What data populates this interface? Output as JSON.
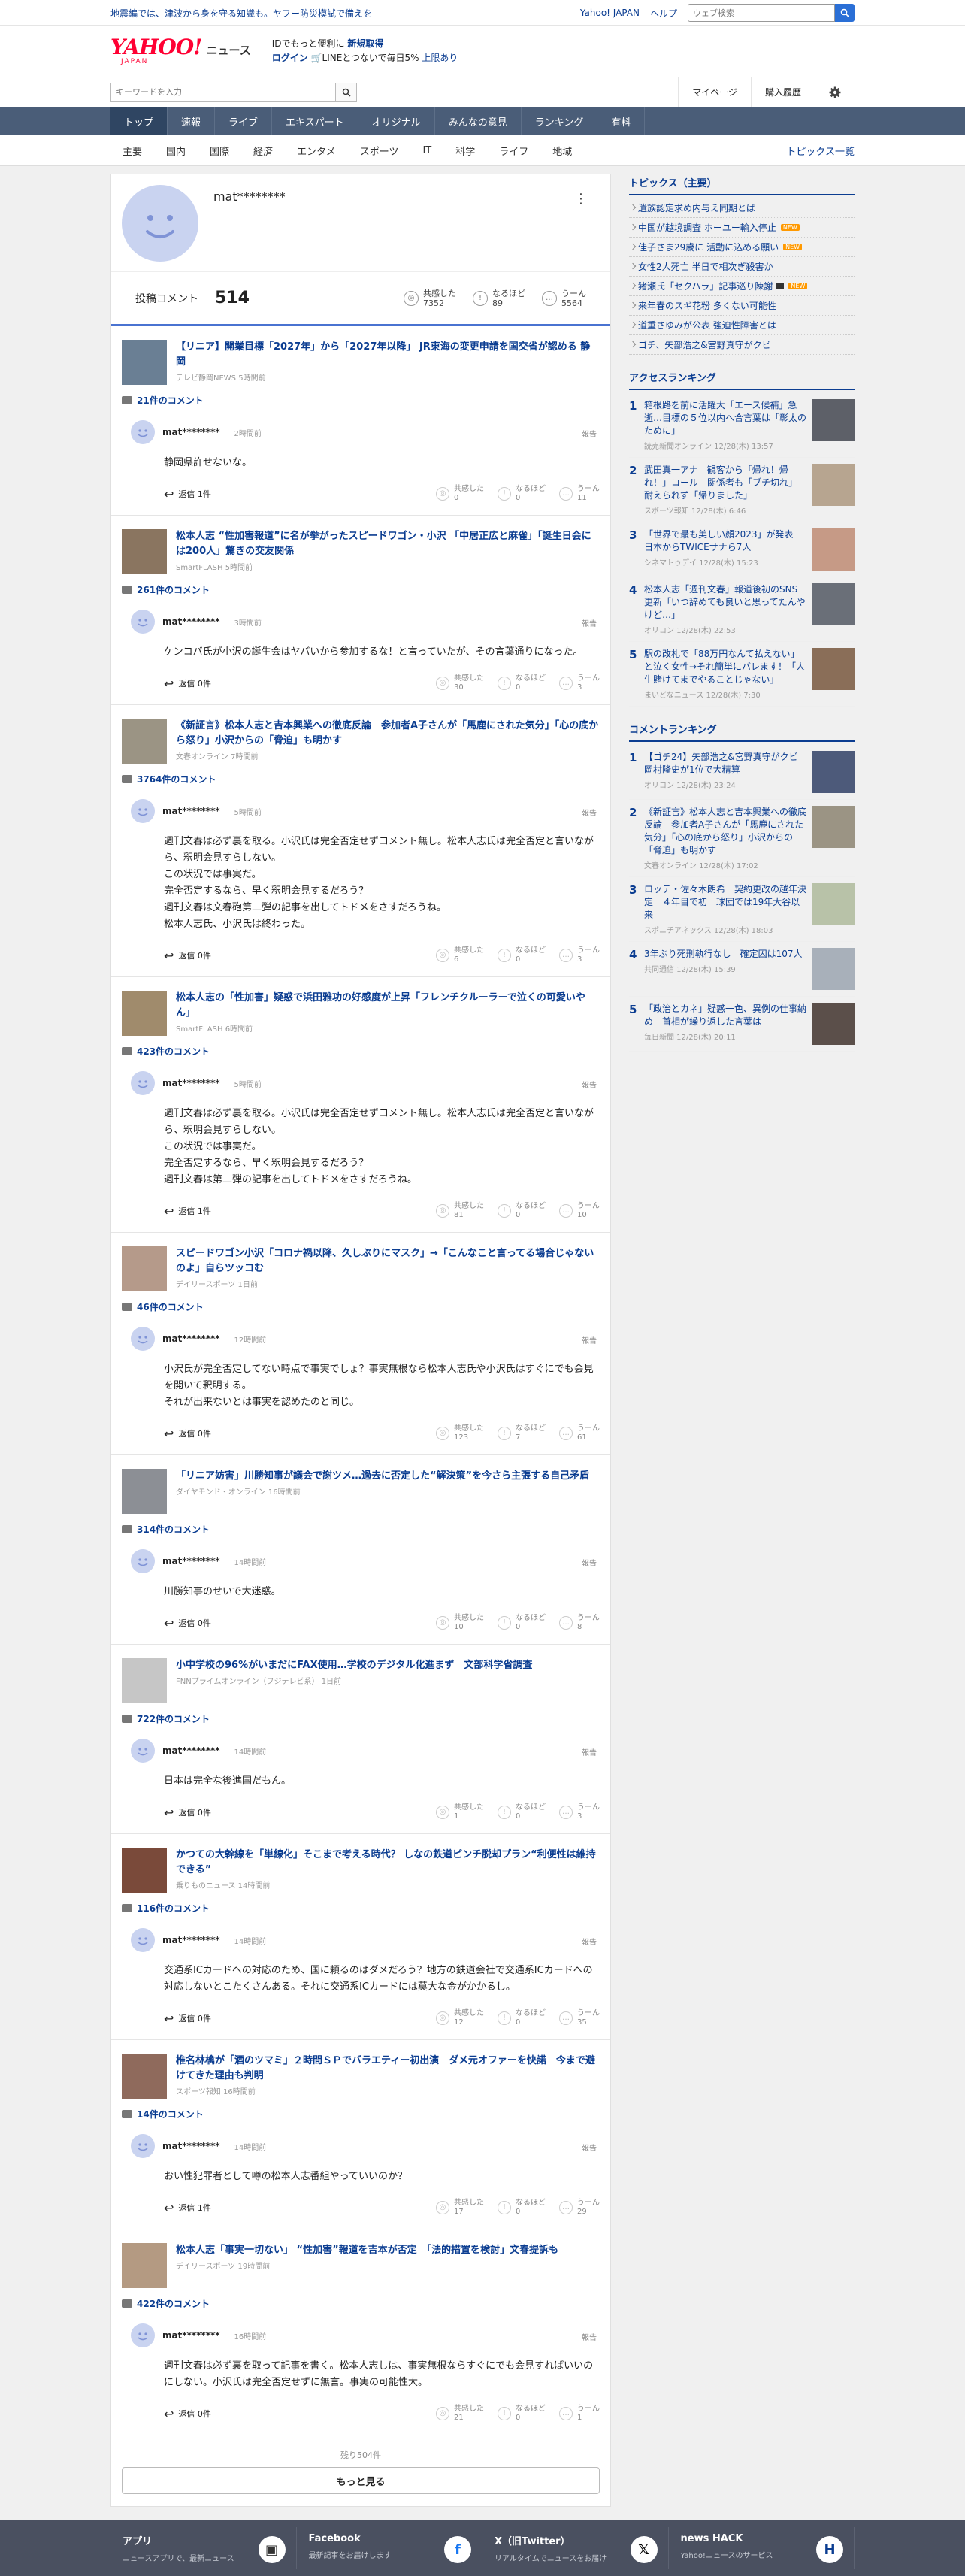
{
  "topbar": {
    "notice": "地震編では、津波から身を守る知識も。ヤフー防災模試で備えを",
    "yahoo_japan": "Yahoo! JAPAN",
    "help": "ヘルプ",
    "web_search_placeholder": "ウェブ検索"
  },
  "header": {
    "logo": "YAHOO!",
    "logo_sub": "JAPAN",
    "logo_news": "ニュース",
    "promo_line1_prefix": "IDでもっと便利に",
    "promo_line1_link": "新規取得",
    "promo_login": "ログイン",
    "promo_line2": "LINEとつないで毎日5%",
    "promo_limit": "上限あり"
  },
  "subbar": {
    "search_placeholder": "キーワードを入力",
    "mypage": "マイページ",
    "history": "購入履歴"
  },
  "gnav": [
    "トップ",
    "速報",
    "ライブ",
    "エキスパート",
    "オリジナル",
    "みんなの意見",
    "ランキング",
    "有料"
  ],
  "cnav": {
    "items": [
      "主要",
      "国内",
      "国際",
      "経済",
      "エンタメ",
      "スポーツ",
      "IT",
      "科学",
      "ライフ",
      "地域"
    ],
    "more": "トピックス一覧"
  },
  "profile": {
    "name": "mat********",
    "posted_label": "投稿コメント",
    "posted_count": "514",
    "reactions": [
      {
        "label": "共感した",
        "count": "7352"
      },
      {
        "label": "なるほど",
        "count": "89"
      },
      {
        "label": "うーん",
        "count": "5564"
      }
    ]
  },
  "comment_labels": {
    "reply_suffix": "返信",
    "report": "報告",
    "empathy": "共感した",
    "naruhodo": "なるほど",
    "uun": "うーん"
  },
  "items": [
    {
      "title": "【リニア】開業目標「2027年」から「2027年以降」 JR東海の変更申請を国交省が認める 静岡",
      "source": "テレビ静岡NEWS 5時間前",
      "comment_count": "21件のコメント",
      "user": "mat********",
      "time": "2時間前",
      "text": "静岡県許せないな。",
      "replies": "返信 1件",
      "empathy": "0",
      "naruhodo": "0",
      "uun": "11"
    },
    {
      "title": "松本人志 “性加害報道”に名が挙がったスピードワゴン・小沢 「中居正広と麻雀」「誕生日会には200人」驚きの交友関係",
      "source": "SmartFLASH 5時間前",
      "comment_count": "261件のコメント",
      "user": "mat********",
      "time": "3時間前",
      "text": "ケンコバ氏が小沢の誕生会はヤバいから参加するな！と言っていたが、その言葉通りになった。",
      "replies": "返信 0件",
      "empathy": "30",
      "naruhodo": "0",
      "uun": "3"
    },
    {
      "title": "《新証言》松本人志と吉本興業への徹底反論　参加者A子さんが「馬鹿にされた気分」「心の底から怒り」小沢からの「脅迫」も明かす",
      "source": "文春オンライン 7時間前",
      "comment_count": "3764件のコメント",
      "user": "mat********",
      "time": "5時間前",
      "text": "週刊文春は必ず裏を取る。小沢氏は完全否定せずコメント無し。松本人志氏は完全否定と言いながら、釈明会見すらしない。\nこの状況では事実だ。\n完全否定するなら、早く釈明会見するだろう？\n週刊文春は文春砲第二弾の記事を出してトドメをさすだろうね。\n松本人志氏、小沢氏は終わった。",
      "replies": "返信 0件",
      "empathy": "6",
      "naruhodo": "0",
      "uun": "3"
    },
    {
      "title": "松本人志の「性加害」疑惑で浜田雅功の好感度が上昇「フレンチクルーラーで泣くの可愛いやん」",
      "source": "SmartFLASH 6時間前",
      "comment_count": "423件のコメント",
      "user": "mat********",
      "time": "5時間前",
      "text": "週刊文春は必ず裏を取る。小沢氏は完全否定せずコメント無し。松本人志氏は完全否定と言いながら、釈明会見すらしない。\nこの状況では事実だ。\n完全否定するなら、早く釈明会見するだろう？\n週刊文春は第二弾の記事を出してトドメをさすだろうね。",
      "replies": "返信 1件",
      "empathy": "81",
      "naruhodo": "0",
      "uun": "10"
    },
    {
      "title": "スピードワゴン小沢「コロナ禍以降、久しぶりにマスク」→「こんなこと言ってる場合じゃないのよ」自らツッコむ",
      "source": "デイリースポーツ 1日前",
      "comment_count": "46件のコメント",
      "user": "mat********",
      "time": "12時間前",
      "text": "小沢氏が完全否定してない時点で事実でしょ？事実無根なら松本人志氏や小沢氏はすぐにでも会見を開いて釈明する。\nそれが出来ないとは事実を認めたのと同じ。",
      "replies": "返信 0件",
      "empathy": "123",
      "naruhodo": "7",
      "uun": "61"
    },
    {
      "title": "「リニア妨害」川勝知事が議会で謝ツメ…過去に否定した“解決策”を今さら主張する自己矛盾",
      "source": "ダイヤモンド・オンライン 16時間前",
      "comment_count": "314件のコメント",
      "user": "mat********",
      "time": "14時間前",
      "text": "川勝知事のせいで大迷惑。",
      "replies": "返信 0件",
      "empathy": "10",
      "naruhodo": "0",
      "uun": "8"
    },
    {
      "title": "小中学校の96%がいまだにFAX使用…学校のデジタル化進まず　文部科学省調査",
      "source": "FNNプライムオンライン（フジテレビ系） 1日前",
      "comment_count": "722件のコメント",
      "user": "mat********",
      "time": "14時間前",
      "text": "日本は完全な後進国だもん。",
      "replies": "返信 0件",
      "empathy": "1",
      "naruhodo": "0",
      "uun": "3"
    },
    {
      "title": "かつての大幹線を「単線化」そこまで考える時代？ しなの鉄道ピンチ脱却プラン“利便性は維持できる”",
      "source": "乗りものニュース 14時間前",
      "comment_count": "116件のコメント",
      "user": "mat********",
      "time": "14時間前",
      "text": "交通系ICカードへの対応のため、国に頼るのはダメだろう？地方の鉄道会社で交通系ICカードへの対応しないとこたくさんある。それに交通系ICカードには莫大な金がかかるし。",
      "replies": "返信 0件",
      "empathy": "12",
      "naruhodo": "0",
      "uun": "35"
    },
    {
      "title": "椎名林檎が「酒のツマミ」２時間ＳＰでバラエティー初出演　ダメ元オファーを快諾　今まで避けてきた理由も判明",
      "source": "スポーツ報知 16時間前",
      "comment_count": "14件のコメント",
      "user": "mat********",
      "time": "14時間前",
      "text": "おい性犯罪者として噂の松本人志番組やっていいのか？",
      "replies": "返信 1件",
      "empathy": "17",
      "naruhodo": "0",
      "uun": "29"
    },
    {
      "title": "松本人志「事実一切ない」 “性加害”報道を吉本が否定　「法的措置を検討」文春提訴も",
      "source": "デイリースポーツ 19時間前",
      "comment_count": "422件のコメント",
      "user": "mat********",
      "time": "16時間前",
      "text": "週刊文春は必ず裏を取って記事を書く。松本人志しは、事実無根ならすぐにでも会見すればいいのにしない。小沢氏は完全否定せずに無言。事実の可能性大。",
      "replies": "返信 0件",
      "empathy": "21",
      "naruhodo": "0",
      "uun": "1"
    }
  ],
  "remain": "残り504件",
  "more_button": "もっと見る",
  "topics": {
    "heading": "トピックス（主要）",
    "items": [
      {
        "text": "遺族認定求め内与え同期とば",
        "badge": ""
      },
      {
        "text": "中国が越境調査 ホーユー輸入停止",
        "badge": "NEW"
      },
      {
        "text": "佳子さま29歳に 活動に込める願い",
        "badge": "NEW"
      },
      {
        "text": "女性2人死亡 半日で相次ぎ殺害か",
        "badge": ""
      },
      {
        "text": "猪瀬氏「セクハラ」記事巡り陳謝",
        "badge": "cam"
      },
      {
        "text": "来年春のスギ花粉 多くない可能性",
        "badge": ""
      },
      {
        "text": "道重さゆみが公表 強迫性障害とは",
        "badge": ""
      },
      {
        "text": "ゴチ、矢部浩之&宮野真守がクビ",
        "badge": ""
      }
    ]
  },
  "access_ranking": {
    "heading": "アクセスランキング",
    "items": [
      {
        "no": "1",
        "title": "箱根路を前に活躍大「エース候補」急逝…目標の５位以内へ合言葉は「彰太のために」",
        "source": "読売新聞オンライン 12/28(木) 13:57"
      },
      {
        "no": "2",
        "title": "武田真一アナ　観客から「帰れ！帰れ！」コール　関係者も「ブチ切れ」　耐えられず「帰りました」",
        "source": "スポーツ報知 12/28(木) 6:46"
      },
      {
        "no": "3",
        "title": "「世界で最も美しい顔2023」が発表　日本からTWICEサナら7人",
        "source": "シネマトゥデイ 12/28(木) 15:23"
      },
      {
        "no": "4",
        "title": "松本人志「週刊文春」報道後初のSNS更新「いつ辞めても良いと思ってたんやけど…」",
        "source": "オリコン 12/28(木) 22:53"
      },
      {
        "no": "5",
        "title": "駅の改札で「88万円なんて払えない」と泣く女性→それ簡単にバレます！「人生賭けてまでやることじゃない」",
        "source": "まいどなニュース 12/28(木) 7:30"
      }
    ]
  },
  "comment_ranking": {
    "heading": "コメントランキング",
    "items": [
      {
        "no": "1",
        "title": "【ゴチ24】矢部浩之&宮野真守がクビ　岡村隆史が1位で大精算",
        "source": "オリコン 12/28(木) 23:24"
      },
      {
        "no": "2",
        "title": "《新証言》松本人志と吉本興業への徹底反論　参加者A子さんが「馬鹿にされた気分」「心の底から怒り」小沢からの「脅迫」も明かす",
        "source": "文春オンライン 12/28(木) 17:02"
      },
      {
        "no": "3",
        "title": "ロッテ・佐々木朗希　契約更改の越年決定　４年目で初　球団では19年大谷以来",
        "source": "スポニチアネックス 12/28(木) 18:03"
      },
      {
        "no": "4",
        "title": "3年ぶり死刑執行なし　確定囚は107人",
        "source": "共同通信 12/28(木) 15:39"
      },
      {
        "no": "5",
        "title": "「政治とカネ」疑惑一色、異例の仕事納め　首相が繰り返した言葉は",
        "source": "毎日新聞 12/28(木) 20:11"
      }
    ]
  },
  "footer": [
    {
      "title": "アプリ",
      "sub": "ニュースアプリで、最新ニュース",
      "icon": "app-icon"
    },
    {
      "title": "Facebook",
      "sub": "最新記事をお届けします",
      "icon": "facebook-icon"
    },
    {
      "title": "X（旧Twitter）",
      "sub": "リアルタイムでニュースをお届け",
      "icon": "x-icon"
    },
    {
      "title": "news HACK",
      "sub": "Yahoo!ニュースのサービス",
      "icon": "newshack-icon"
    }
  ]
}
